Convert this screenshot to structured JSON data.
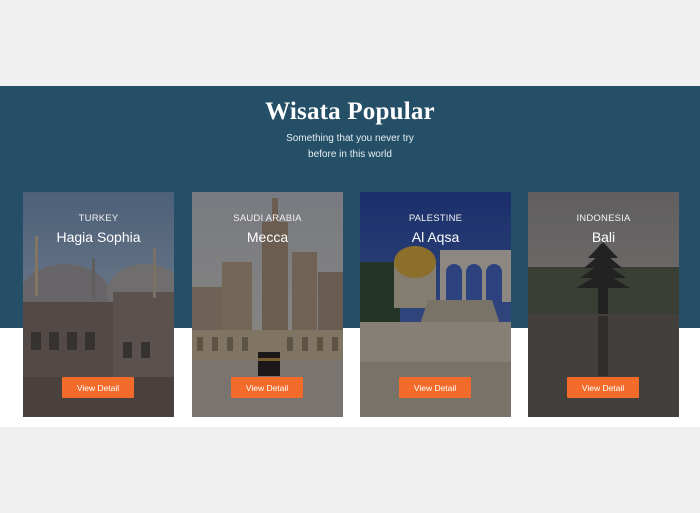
{
  "section": {
    "title": "Wisata Popular",
    "subtitle_line1": "Something that you never try",
    "subtitle_line2": "before in this world"
  },
  "cards": [
    {
      "country": "TURKEY",
      "place": "Hagia Sophia",
      "button": "View Detail"
    },
    {
      "country": "SAUDI ARABIA",
      "place": "Mecca",
      "button": "View Detail"
    },
    {
      "country": "PALESTINE",
      "place": "Al Aqsa",
      "button": "View Detail"
    },
    {
      "country": "INDONESIA",
      "place": "Bali",
      "button": "View Detail"
    }
  ],
  "colors": {
    "band": "#244f66",
    "button": "#f26b2a",
    "page_background": "#f0f0f0"
  }
}
